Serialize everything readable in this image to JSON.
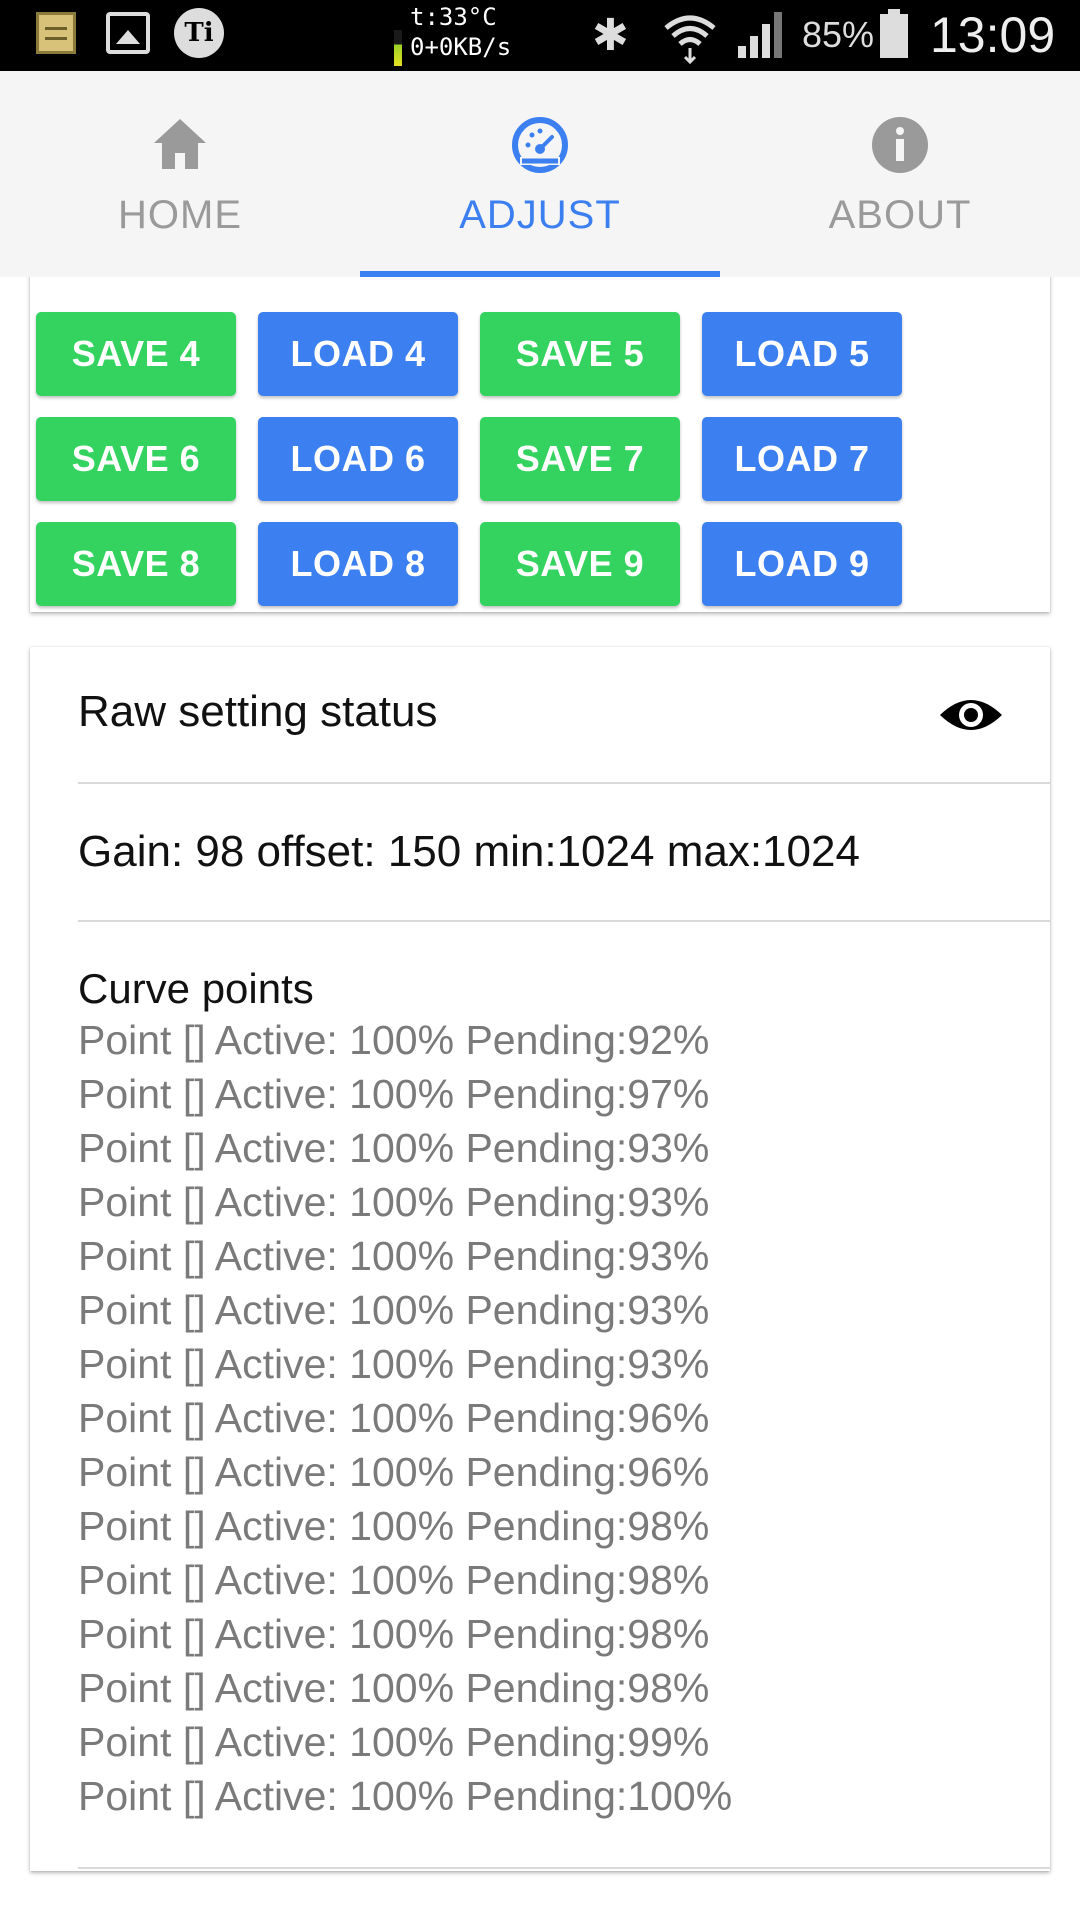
{
  "status_bar": {
    "temp": "t:33°C",
    "net": "0+0KB/s",
    "battery": "85%",
    "time": "13:09",
    "icons": [
      "notes-icon",
      "gallery-icon",
      "ti-app-icon",
      "bluetooth-icon",
      "wifi-icon",
      "signal-icon",
      "battery-icon"
    ]
  },
  "tabs": [
    {
      "label": "HOME",
      "icon": "home-icon",
      "active": false
    },
    {
      "label": "ADJUST",
      "icon": "speedometer-icon",
      "active": true
    },
    {
      "label": "ABOUT",
      "icon": "info-icon",
      "active": false
    }
  ],
  "buttons": {
    "rows": [
      [
        "SAVE 4",
        "LOAD 4",
        "SAVE 5",
        "LOAD 5"
      ],
      [
        "SAVE 6",
        "LOAD 6",
        "SAVE 7",
        "LOAD 7"
      ],
      [
        "SAVE 8",
        "LOAD 8",
        "SAVE 9",
        "LOAD 9"
      ]
    ],
    "save_color": "#34d35f",
    "load_color": "#3c7ff0"
  },
  "status": {
    "title": "Raw setting status",
    "gain_line": "Gain: 98 offset: 150 min:1024 max:1024",
    "curve_title": "Curve points",
    "points": [
      "Point [] Active: 100% Pending:92%",
      "Point [] Active: 100% Pending:97%",
      "Point [] Active: 100% Pending:93%",
      "Point [] Active: 100% Pending:93%",
      "Point [] Active: 100% Pending:93%",
      "Point [] Active: 100% Pending:93%",
      "Point [] Active: 100% Pending:93%",
      "Point [] Active: 100% Pending:96%",
      "Point [] Active: 100% Pending:96%",
      "Point [] Active: 100% Pending:98%",
      "Point [] Active: 100% Pending:98%",
      "Point [] Active: 100% Pending:98%",
      "Point [] Active: 100% Pending:98%",
      "Point [] Active: 100% Pending:99%",
      "Point [] Active: 100% Pending:100%"
    ]
  },
  "accent_color": "#3c7ff0"
}
